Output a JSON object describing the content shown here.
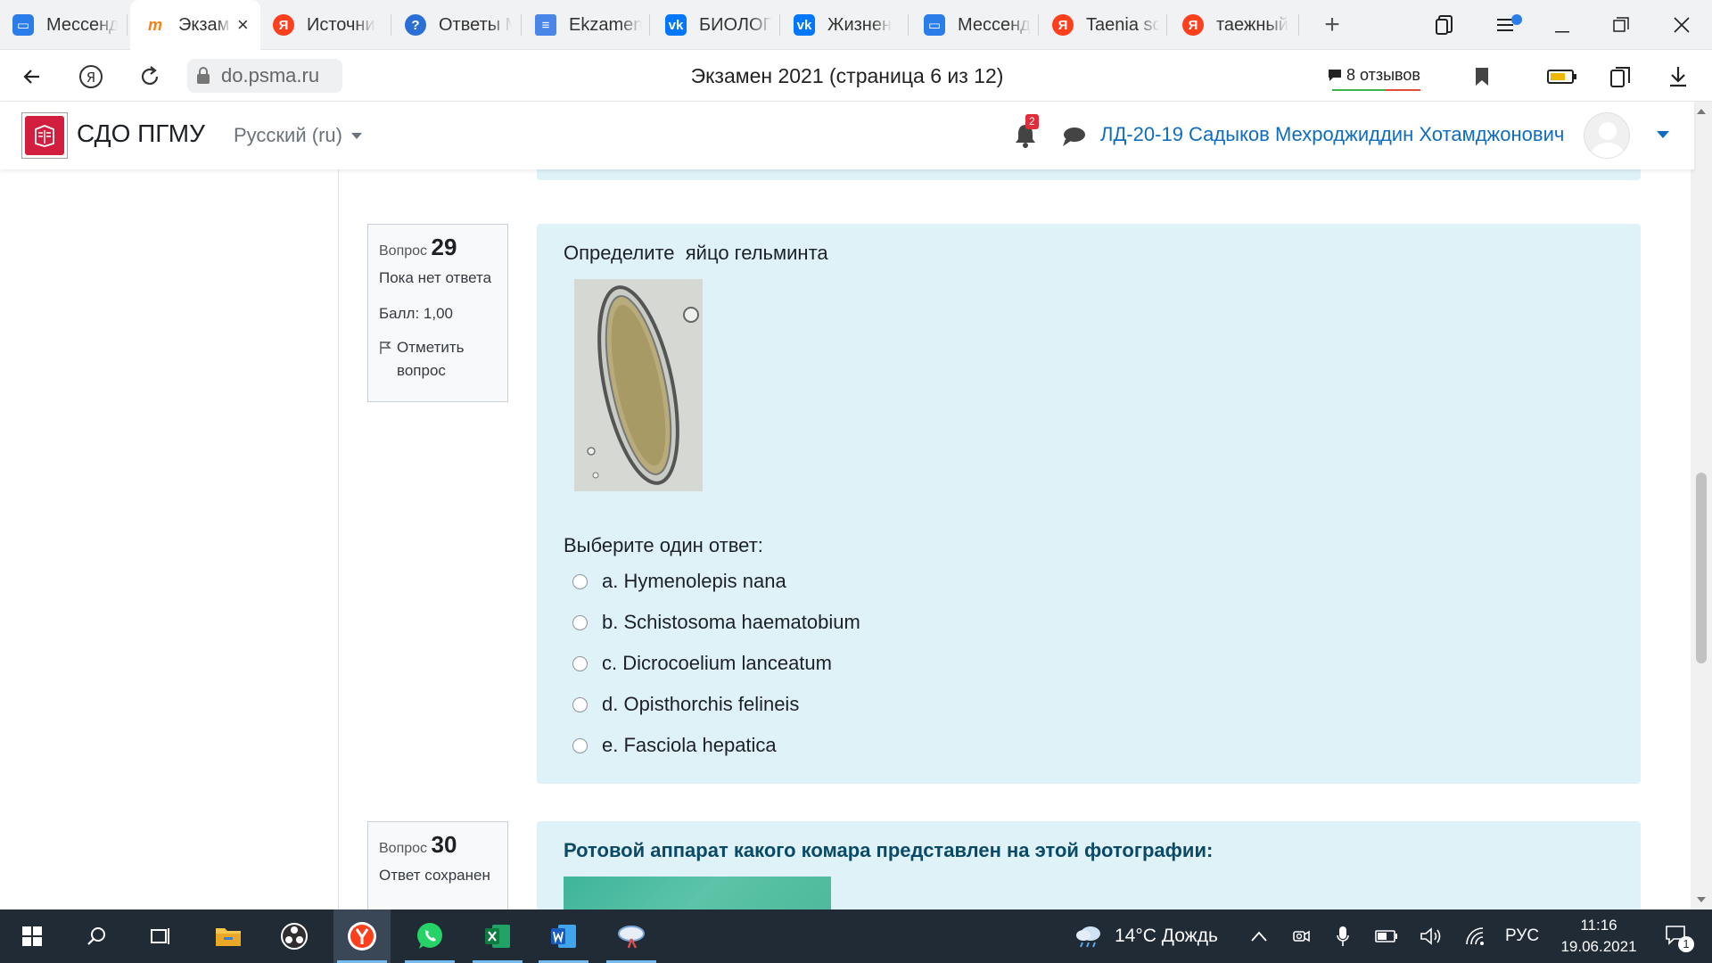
{
  "browser": {
    "tabs": [
      {
        "label": "Мессенд",
        "icon": "messenger-icon",
        "color": "#2b7de9"
      },
      {
        "label": "Экзам",
        "icon": "moodle-icon",
        "color": "#f98012",
        "active": true
      },
      {
        "label": "Источни",
        "icon": "yandex-icon",
        "color": "#fc3f1d"
      },
      {
        "label": "Ответы М",
        "icon": "question-icon",
        "color": "#2b6fd6"
      },
      {
        "label": "Ekzamen",
        "icon": "document-icon",
        "color": "#4a86e8"
      },
      {
        "label": "БИОЛОГ",
        "icon": "vk-icon",
        "color": "#0077ff"
      },
      {
        "label": "Жизнен",
        "icon": "vk-icon",
        "color": "#0077ff"
      },
      {
        "label": "Мессенд",
        "icon": "messenger-icon",
        "color": "#2b7de9"
      },
      {
        "label": "Taenia so",
        "icon": "yandex-icon",
        "color": "#fc3f1d"
      },
      {
        "label": "таежный",
        "icon": "yandex-icon",
        "color": "#fc3f1d"
      }
    ],
    "active_tab_close": "×",
    "new_tab": "+",
    "url": "do.psma.ru",
    "page_title": "Экзамен 2021 (страница 6 из 12)",
    "reviews": "8 отзывов"
  },
  "site": {
    "name": "СДО ПГМУ",
    "language": "Русский (ru)",
    "notifications_count": "2",
    "user_name": "ЛД-20-19 Садыков Мехроджиддин Хотамджонович"
  },
  "q29": {
    "prefix": "Вопрос",
    "number": "29",
    "status": "Пока нет ответа",
    "score": "Балл: 1,00",
    "flag": "Отметить вопрос",
    "text": "Определите  яйцо гельминта",
    "prompt": "Выберите один ответ:",
    "options": [
      "a. Hymenolepis nana",
      "b. Schistosoma haematobium",
      "c. Dicrocoelium lanceatum",
      "d. Opisthorchis felineis",
      "e. Fasciola hepatica"
    ]
  },
  "q30": {
    "prefix": "Вопрос",
    "number": "30",
    "status": "Ответ сохранен",
    "text": "Ротовой аппарат какого комара представлен на этой фотографии:"
  },
  "taskbar": {
    "weather": "14°C Дождь",
    "lang": "РУС",
    "time": "11:16",
    "date": "19.06.2021",
    "notif_count": "1"
  },
  "colors": {
    "accent": "#0f6cbf",
    "question_bg": "#def2f8",
    "taskbar": "#202b36",
    "badge": "#e12d39"
  }
}
